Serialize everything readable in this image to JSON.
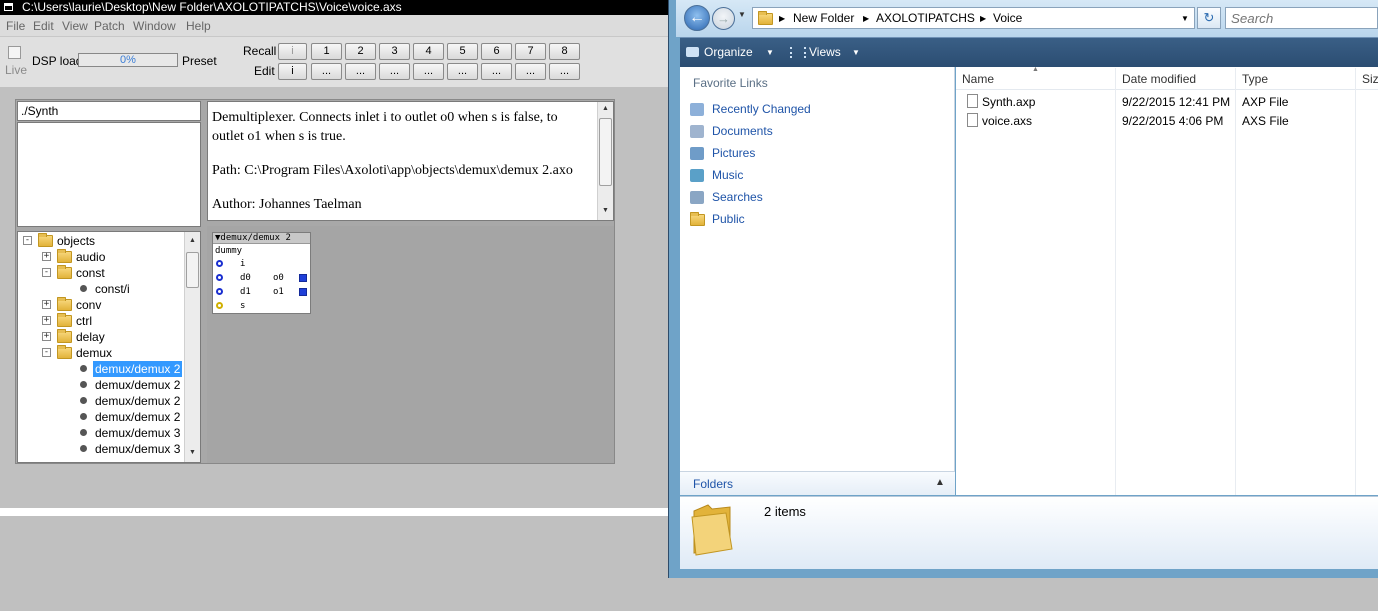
{
  "axoloti": {
    "title": "C:\\Users\\laurie\\Desktop\\New Folder\\AXOLOTIPATCHS\\Voice\\voice.axs",
    "menu": [
      "File",
      "Edit",
      "View",
      "Patch",
      "Window",
      "Help"
    ],
    "toolbar": {
      "live_label": "Live",
      "dsp_label": "DSP load",
      "dsp_value": "0%",
      "preset_label": "Preset",
      "recall_label": "Recall",
      "edit_label": "Edit",
      "recall_buttons": [
        "i",
        "1",
        "2",
        "3",
        "4",
        "5",
        "6",
        "7",
        "8"
      ],
      "edit_buttons": [
        "i",
        "...",
        "...",
        "...",
        "...",
        "...",
        "...",
        "...",
        "..."
      ]
    },
    "object_browser": {
      "search_value": "./Synth",
      "description": "Demultiplexer. Connects inlet i to outlet o0 when s is false, to outlet o1 when s is true.",
      "path": "Path: C:\\Program Files\\Axoloti\\app\\objects\\demux\\demux 2.axo",
      "author": "Author: Johannes Taelman",
      "tree": {
        "root": "objects",
        "items": [
          "audio",
          "const",
          "const/i",
          "conv",
          "ctrl",
          "delay",
          "demux",
          "demux/demux 2",
          "demux/demux 2",
          "demux/demux 2",
          "demux/demux 2",
          "demux/demux 3",
          "demux/demux 3"
        ]
      },
      "preview": {
        "header": "▼demux/demux 2",
        "instance": "dummy",
        "inlets": [
          "i",
          "d0",
          "d1",
          "s"
        ],
        "outlets": [
          "o0",
          "o1"
        ]
      }
    }
  },
  "explorer": {
    "address": [
      "New Folder",
      "AXOLOTIPATCHS",
      "Voice"
    ],
    "search_placeholder": "Search",
    "commands": {
      "organize": "Organize",
      "views": "Views"
    },
    "favorites_header": "Favorite Links",
    "favorites": [
      "Recently Changed",
      "Documents",
      "Pictures",
      "Music",
      "Searches",
      "Public"
    ],
    "folders_label": "Folders",
    "columns": [
      "Name",
      "Date modified",
      "Type",
      "Size"
    ],
    "files": [
      {
        "name": "Synth.axp",
        "date": "9/22/2015 12:41 PM",
        "type": "AXP File"
      },
      {
        "name": "voice.axs",
        "date": "9/22/2015 4:06 PM",
        "type": "AXS File"
      }
    ],
    "status": "2 items"
  }
}
